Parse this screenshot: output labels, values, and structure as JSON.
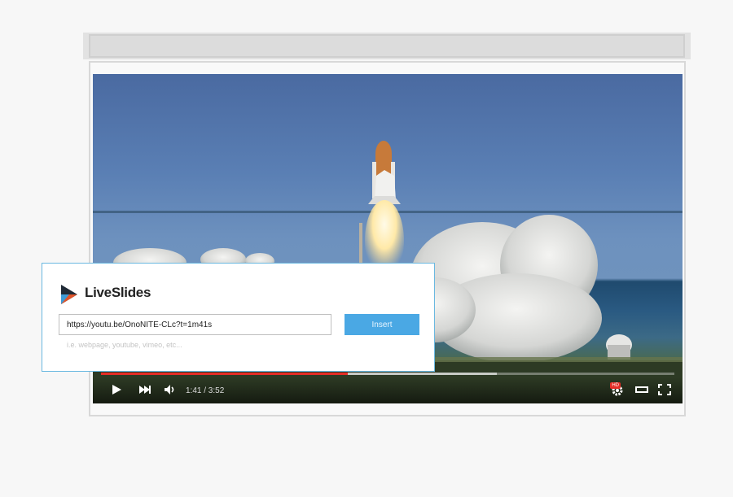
{
  "player": {
    "time": "1:41 / 3:52",
    "hd_badge": "HD",
    "progress_fraction": 0.43,
    "buffer_fraction": 0.69
  },
  "dialog": {
    "brand": "LiveSlides",
    "url_value": "https://youtu.be/OnoNITE-CLc?t=1m41s",
    "insert_label": "Insert",
    "hint": "i.e. webpage, youtube, vimeo, etc..."
  },
  "icons": {
    "play": "play-icon",
    "next": "next-icon",
    "volume": "volume-icon",
    "settings": "gear-icon",
    "theater": "theater-mode-icon",
    "fullscreen": "fullscreen-icon",
    "logo": "liveslides-logo-icon"
  },
  "colors": {
    "progress": "#e52d27",
    "insert_button": "#4aa8e4",
    "dialog_border": "#6ab8e0"
  }
}
